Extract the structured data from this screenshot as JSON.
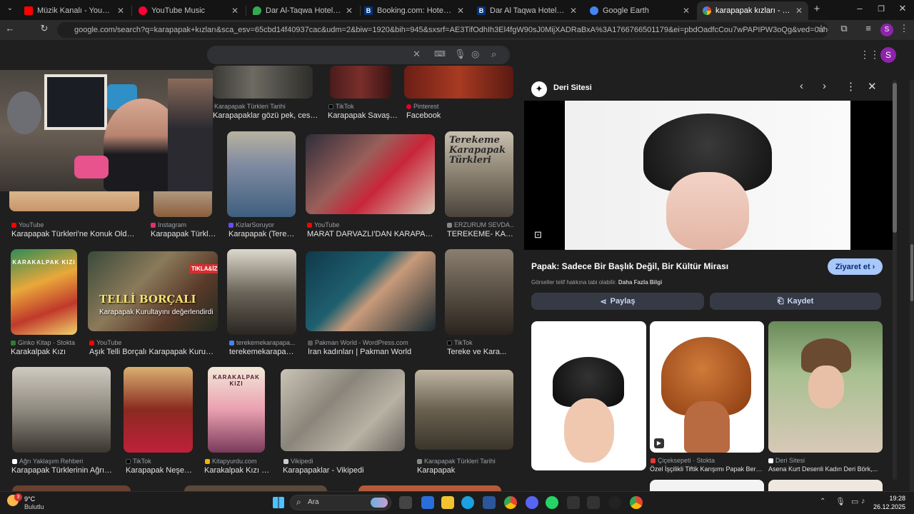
{
  "tabs": [
    {
      "label": "Müzik Kanalı - YouTube",
      "color": "#ff0000"
    },
    {
      "label": "YouTube Music",
      "color": "#ff0033"
    },
    {
      "label": "Dar Al-Taqwa Hotel Madinah -",
      "color": "#34a853"
    },
    {
      "label": "Booking.com: Hotels in Medine",
      "color": "#003580"
    },
    {
      "label": "Dar Al Taqwa Hotel, Medine (2",
      "color": "#003580"
    },
    {
      "label": "Google Earth",
      "color": "#4285f4"
    },
    {
      "label": "karapapak kızları - Google'da A",
      "color": "#4285f4"
    }
  ],
  "address": {
    "url": "google.com/search?q=karapapak+kızları&sca_esv=65cbd14f40937cac&udm=2&biw=1920&bih=945&sxsrf=AE3TifOdhIh3El4fgW90sJ0MijXADRaBxA%3A1766766501179&ei=pbdOadfcCou7wPAPIPW3oQg&ved=0ahUKEwiXw9CN1tuRAxWLHRAIHZ..."
  },
  "profile_initial": "S",
  "row1": [
    {
      "source": "Karapapak Türkleri Tarihi",
      "caption": "Karapapaklar gözü pek, cesur, sava..."
    },
    {
      "source": "TikTok",
      "caption": "Karapapak Savaşç..."
    },
    {
      "source": "Pinterest",
      "caption": "Facebook"
    }
  ],
  "row2": [
    {
      "source": "YouTube",
      "caption": "Karapapak Türkleri'ne Konuk Olduk - İf...",
      "color": "#ff0000"
    },
    {
      "source": "Instagram",
      "caption": "Karapapak Türkleri...",
      "color": "#e1306c"
    },
    {
      "source": "KizlarSoruyor",
      "caption": "Karapapak (Tereke...",
      "color": "#6a4cff"
    },
    {
      "source": "YouTube",
      "caption": "MARAT DARVAZLI'DAN KARAPAPAK ...",
      "color": "#ff0000"
    },
    {
      "source": "ERZURUM SEVDA...",
      "caption": "TEREKEME- KAR...",
      "color": "#888888"
    }
  ],
  "row3": [
    {
      "source": "Ginko Kitap · Stokta",
      "caption": "Karakalpak Kızı",
      "color": "#2e7d32"
    },
    {
      "source": "YouTube",
      "caption": "Aşık Telli Borçalı Karapapak Kurultayı'...",
      "color": "#ff0000"
    },
    {
      "source": "terekemekarapapa...",
      "caption": "terekemekarapapa...",
      "color": "#4285f4"
    },
    {
      "source": "Pakman World - WordPress.com",
      "caption": "İran kadınları | Pakman World",
      "color": "#5a5a5a"
    },
    {
      "source": "TikTok",
      "caption": "Tereke ve Kara...",
      "color": "#000000"
    }
  ],
  "row4": [
    {
      "source": "Ağrı Yaklaşım Rehberi",
      "caption": "Karapapak Türklerinin Ağrı'ya ...",
      "color": "#ffffff"
    },
    {
      "source": "TikTok",
      "caption": "Karapapak Neşesi:...",
      "color": "#000000"
    },
    {
      "source": "Kitapyurdu.com",
      "caption": "Karakalpak Kızı (T...",
      "color": "#f4b400"
    },
    {
      "source": "Vikipedi",
      "caption": "Karapapaklar - Vikipedi",
      "color": "#cccccc"
    },
    {
      "source": "Karapapak Türkleri Tarihi",
      "caption": "Karapapak",
      "color": "#888888"
    }
  ],
  "image_texts": {
    "terekeme": "Terekeme Karapapak Türkleri",
    "karakalpak": "KARAKALPAK KIZI",
    "telli": "TELLİ BORÇALI",
    "telli_sub": "Karapapak Kurultayını değerlendirdi",
    "tiklasi": "TIKLA&İZ",
    "karakalpak2": "KARAKALPAK KIZI"
  },
  "panel": {
    "site": "Deri Sitesi",
    "title": "Papak: Sadece Bir Başlık Değil, Bir Kültür Mirası",
    "visit": "Ziyaret et",
    "copyright": "Görseller telif hakkına tabi olabilir.",
    "more_info": "Daha Fazla Bilgi",
    "share": "Paylaş",
    "save": "Kaydet",
    "related": [
      {
        "source": "",
        "caption": ""
      },
      {
        "source": "Çiçeksepeti · Stokta",
        "caption": "Özel İşçilikli Tiftik Karışımı Papak Bere..."
      },
      {
        "source": "Deri Sitesi",
        "caption": "Asena Kurt Desenli Kadın Deri Börk,..."
      }
    ]
  },
  "taskbar": {
    "temp": "9°C",
    "weather": "Bulutlu",
    "search": "Ara",
    "time": "19:28",
    "date": "26.12.2025",
    "badge": "3"
  }
}
